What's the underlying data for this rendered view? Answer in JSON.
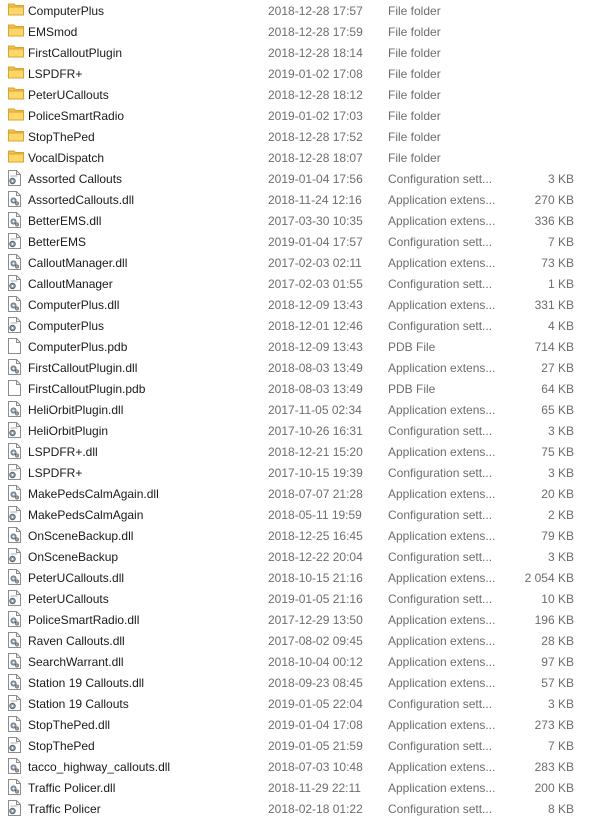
{
  "files": [
    {
      "name": "ComputerPlus",
      "date": "2018-12-28 17:57",
      "type": "File folder",
      "size": "",
      "icon": "folder-icon"
    },
    {
      "name": "EMSmod",
      "date": "2018-12-28 17:59",
      "type": "File folder",
      "size": "",
      "icon": "folder-icon"
    },
    {
      "name": "FirstCalloutPlugin",
      "date": "2018-12-28 18:14",
      "type": "File folder",
      "size": "",
      "icon": "folder-icon"
    },
    {
      "name": "LSPDFR+",
      "date": "2019-01-02 17:08",
      "type": "File folder",
      "size": "",
      "icon": "folder-icon"
    },
    {
      "name": "PeterUCallouts",
      "date": "2018-12-28 18:12",
      "type": "File folder",
      "size": "",
      "icon": "folder-icon"
    },
    {
      "name": "PoliceSmartRadio",
      "date": "2019-01-02 17:03",
      "type": "File folder",
      "size": "",
      "icon": "folder-icon"
    },
    {
      "name": "StopThePed",
      "date": "2018-12-28 17:52",
      "type": "File folder",
      "size": "",
      "icon": "folder-icon"
    },
    {
      "name": "VocalDispatch",
      "date": "2018-12-28 18:07",
      "type": "File folder",
      "size": "",
      "icon": "folder-icon"
    },
    {
      "name": "Assorted Callouts",
      "date": "2019-01-04 17:56",
      "type": "Configuration sett...",
      "size": "3 KB",
      "icon": "config-file-icon"
    },
    {
      "name": "AssortedCallouts.dll",
      "date": "2018-11-24 12:16",
      "type": "Application extens...",
      "size": "270 KB",
      "icon": "dll-file-icon"
    },
    {
      "name": "BetterEMS.dll",
      "date": "2017-03-30 10:35",
      "type": "Application extens...",
      "size": "336 KB",
      "icon": "dll-file-icon"
    },
    {
      "name": "BetterEMS",
      "date": "2019-01-04 17:57",
      "type": "Configuration sett...",
      "size": "7 KB",
      "icon": "config-file-icon"
    },
    {
      "name": "CalloutManager.dll",
      "date": "2017-02-03 02:11",
      "type": "Application extens...",
      "size": "73 KB",
      "icon": "dll-file-icon"
    },
    {
      "name": "CalloutManager",
      "date": "2017-02-03 01:55",
      "type": "Configuration sett...",
      "size": "1 KB",
      "icon": "config-file-icon"
    },
    {
      "name": "ComputerPlus.dll",
      "date": "2018-12-09 13:43",
      "type": "Application extens...",
      "size": "331 KB",
      "icon": "dll-file-icon"
    },
    {
      "name": "ComputerPlus",
      "date": "2018-12-01 12:46",
      "type": "Configuration sett...",
      "size": "4 KB",
      "icon": "config-file-icon"
    },
    {
      "name": "ComputerPlus.pdb",
      "date": "2018-12-09 13:43",
      "type": "PDB File",
      "size": "714 KB",
      "icon": "blank-file-icon"
    },
    {
      "name": "FirstCalloutPlugin.dll",
      "date": "2018-08-03 13:49",
      "type": "Application extens...",
      "size": "27 KB",
      "icon": "dll-file-icon"
    },
    {
      "name": "FirstCalloutPlugin.pdb",
      "date": "2018-08-03 13:49",
      "type": "PDB File",
      "size": "64 KB",
      "icon": "blank-file-icon"
    },
    {
      "name": "HeliOrbitPlugin.dll",
      "date": "2017-11-05 02:34",
      "type": "Application extens...",
      "size": "65 KB",
      "icon": "dll-file-icon"
    },
    {
      "name": "HeliOrbitPlugin",
      "date": "2017-10-26 16:31",
      "type": "Configuration sett...",
      "size": "3 KB",
      "icon": "config-file-icon"
    },
    {
      "name": "LSPDFR+.dll",
      "date": "2018-12-21 15:20",
      "type": "Application extens...",
      "size": "75 KB",
      "icon": "dll-file-icon"
    },
    {
      "name": "LSPDFR+",
      "date": "2017-10-15 19:39",
      "type": "Configuration sett...",
      "size": "3 KB",
      "icon": "config-file-icon"
    },
    {
      "name": "MakePedsCalmAgain.dll",
      "date": "2018-07-07 21:28",
      "type": "Application extens...",
      "size": "20 KB",
      "icon": "dll-file-icon"
    },
    {
      "name": "MakePedsCalmAgain",
      "date": "2018-05-11 19:59",
      "type": "Configuration sett...",
      "size": "2 KB",
      "icon": "config-file-icon"
    },
    {
      "name": "OnSceneBackup.dll",
      "date": "2018-12-25 16:45",
      "type": "Application extens...",
      "size": "79 KB",
      "icon": "dll-file-icon"
    },
    {
      "name": "OnSceneBackup",
      "date": "2018-12-22 20:04",
      "type": "Configuration sett...",
      "size": "3 KB",
      "icon": "config-file-icon"
    },
    {
      "name": "PeterUCallouts.dll",
      "date": "2018-10-15 21:16",
      "type": "Application extens...",
      "size": "2 054 KB",
      "icon": "dll-file-icon"
    },
    {
      "name": "PeterUCallouts",
      "date": "2019-01-05 21:16",
      "type": "Configuration sett...",
      "size": "10 KB",
      "icon": "config-file-icon"
    },
    {
      "name": "PoliceSmartRadio.dll",
      "date": "2017-12-29 13:50",
      "type": "Application extens...",
      "size": "196 KB",
      "icon": "dll-file-icon"
    },
    {
      "name": "Raven Callouts.dll",
      "date": "2017-08-02 09:45",
      "type": "Application extens...",
      "size": "28 KB",
      "icon": "dll-file-icon"
    },
    {
      "name": "SearchWarrant.dll",
      "date": "2018-10-04 00:12",
      "type": "Application extens...",
      "size": "97 KB",
      "icon": "dll-file-icon"
    },
    {
      "name": "Station 19 Callouts.dll",
      "date": "2018-09-23 08:45",
      "type": "Application extens...",
      "size": "57 KB",
      "icon": "dll-file-icon"
    },
    {
      "name": "Station 19 Callouts",
      "date": "2019-01-05 22:04",
      "type": "Configuration sett...",
      "size": "3 KB",
      "icon": "config-file-icon"
    },
    {
      "name": "StopThePed.dll",
      "date": "2019-01-04 17:08",
      "type": "Application extens...",
      "size": "273 KB",
      "icon": "dll-file-icon"
    },
    {
      "name": "StopThePed",
      "date": "2019-01-05 21:59",
      "type": "Configuration sett...",
      "size": "7 KB",
      "icon": "config-file-icon"
    },
    {
      "name": "tacco_highway_callouts.dll",
      "date": "2018-07-03 10:48",
      "type": "Application extens...",
      "size": "283 KB",
      "icon": "dll-file-icon"
    },
    {
      "name": "Traffic Policer.dll",
      "date": "2018-11-29 22:11",
      "type": "Application extens...",
      "size": "200 KB",
      "icon": "dll-file-icon"
    },
    {
      "name": "Traffic Policer",
      "date": "2018-02-18 01:22",
      "type": "Configuration sett...",
      "size": "8 KB",
      "icon": "config-file-icon"
    }
  ]
}
